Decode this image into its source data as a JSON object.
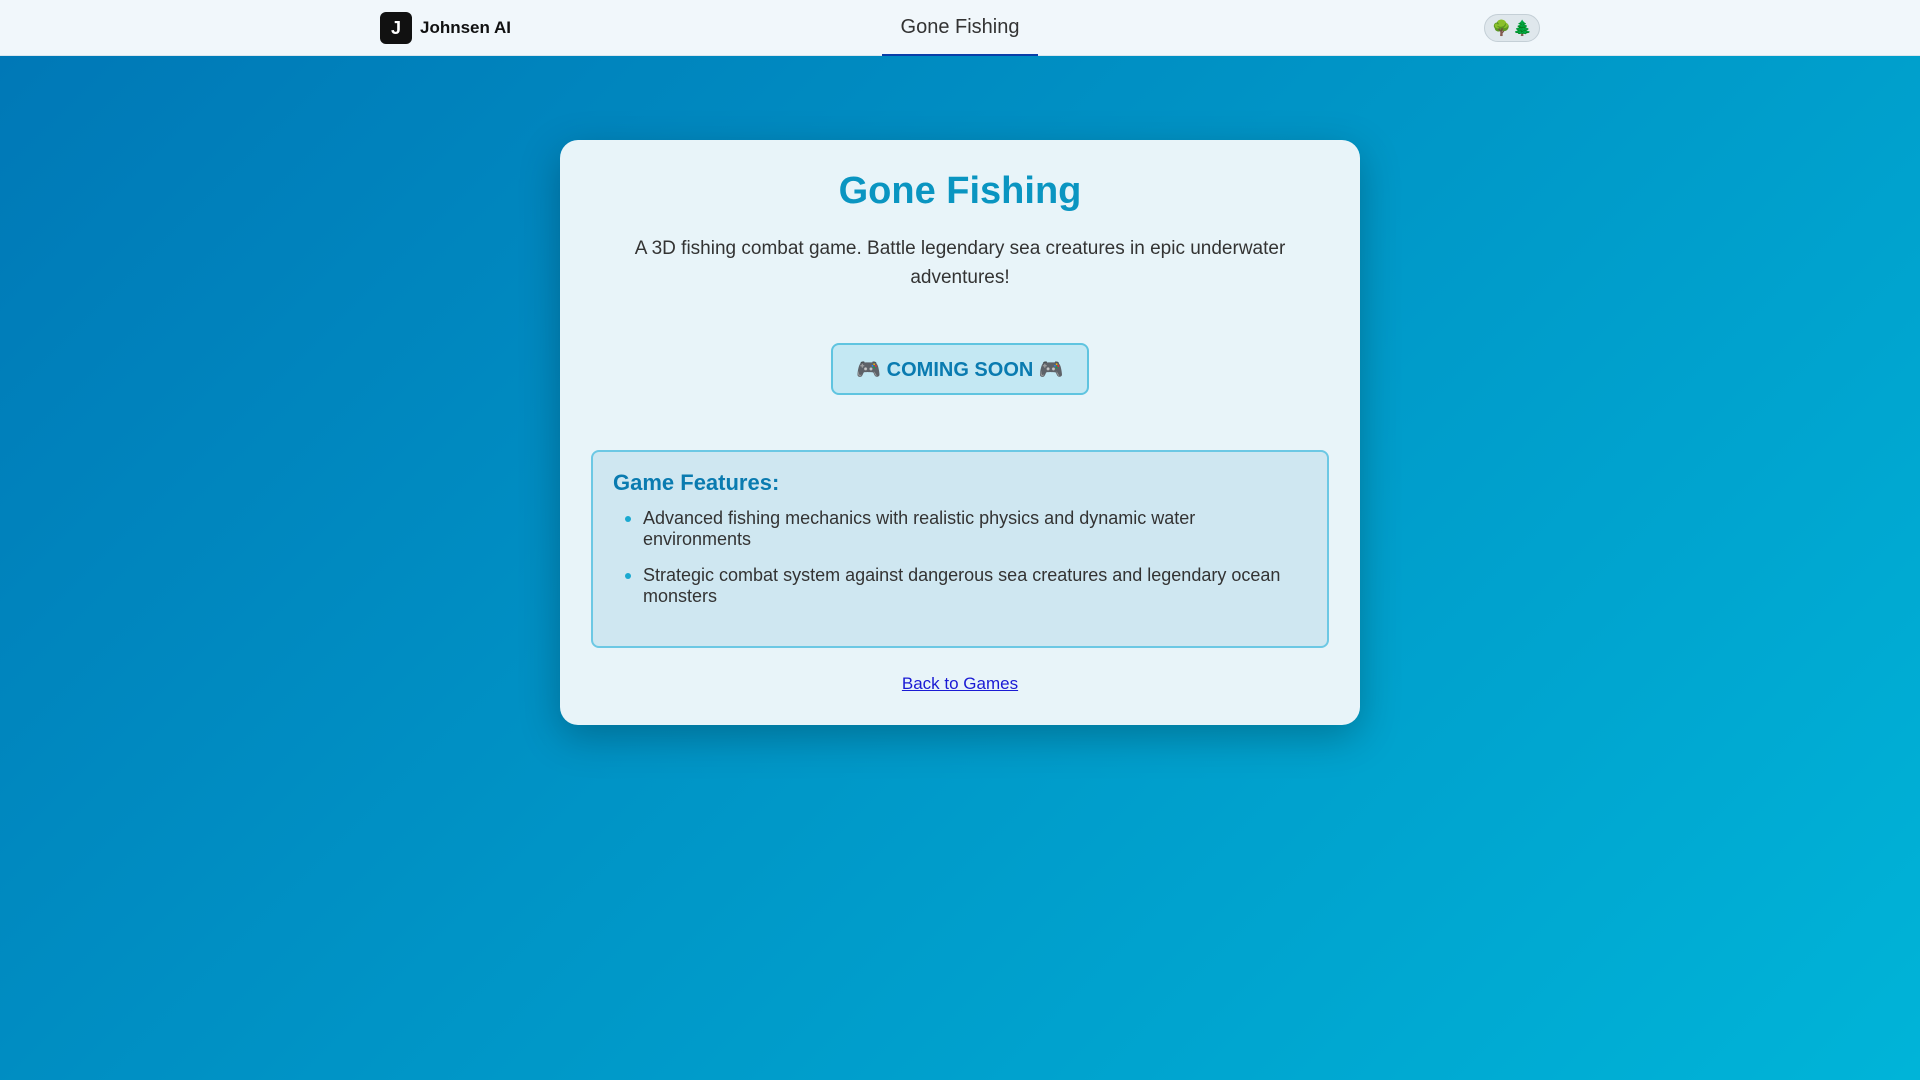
{
  "header": {
    "logo_letter": "J",
    "brand_name": "Johnsen AI",
    "page_title": "Gone Fishing",
    "theme_toggle_icons": [
      "🌳",
      "🌲"
    ]
  },
  "card": {
    "title": "Gone Fishing",
    "description": "A 3D fishing combat game. Battle legendary sea creatures in epic underwater adventures!",
    "status_button": "🎮 COMING SOON 🎮",
    "features": {
      "heading": "Game Features:",
      "items": [
        "Advanced fishing mechanics with realistic physics and dynamic water environments",
        "Strategic combat system against dangerous sea creatures and legendary ocean monsters"
      ]
    },
    "back_link": "Back to Games"
  },
  "colors": {
    "background_start": "#0077b6",
    "background_end": "#00b4d8",
    "title": "#0a95c1",
    "accent": "#0a7bb0"
  }
}
